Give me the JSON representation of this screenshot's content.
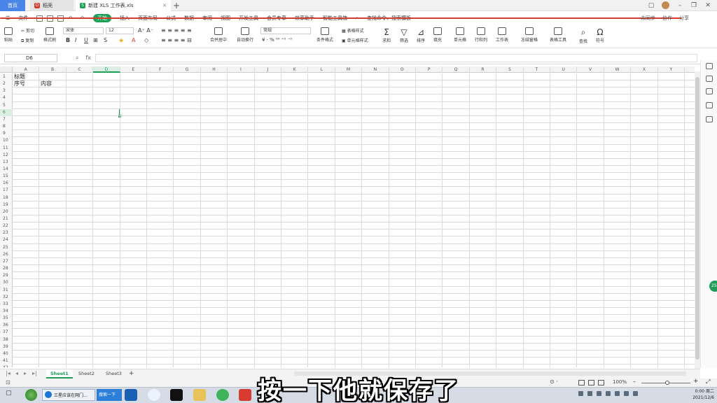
{
  "tabs": {
    "home": "首页",
    "docs": "稻壳",
    "doc": "新建 XLS 工作表.xls",
    "add": "+"
  },
  "menu": {
    "file": "文件",
    "items": [
      "开始",
      "插入",
      "页面布局",
      "公式",
      "数据",
      "审阅",
      "视图",
      "开发工具",
      "会员专享",
      "效率助手",
      "智能工具箱"
    ],
    "search": "查找命令、搜索模板",
    "right": [
      "未同步",
      "协作",
      "分享"
    ]
  },
  "ribbon": {
    "paste": "粘贴",
    "cut": "剪切",
    "copy": "复制",
    "format_painter": "格式刷",
    "font_name": "宋体",
    "font_size": "12",
    "merge": "合并居中",
    "wrap": "自动换行",
    "number_format": "常规",
    "cond_format": "条件格式",
    "table_style": "表格样式",
    "cell_style": "单元格样式",
    "sum": "求和",
    "filter": "筛选",
    "sort": "排序",
    "fill": "填充",
    "cell": "单元格",
    "rowcol": "行和列",
    "sheet": "工作表",
    "freeze": "冻结窗格",
    "table_tools": "表格工具",
    "find": "查找",
    "symbol": "符号"
  },
  "formula": {
    "namebox": "D6",
    "fx": "fx",
    "value": ""
  },
  "columns": [
    "A",
    "B",
    "C",
    "D",
    "E",
    "F",
    "G",
    "H",
    "I",
    "J",
    "K",
    "L",
    "M",
    "N",
    "O",
    "P",
    "Q",
    "R",
    "S",
    "T",
    "U",
    "V",
    "W",
    "X",
    "Y"
  ],
  "selected_column": "D",
  "selected_row": 6,
  "rows": 42,
  "cells": {
    "a1": "标题",
    "a2": "序号",
    "b2": "内容"
  },
  "sheets": [
    "Sheet1",
    "Sheet2",
    "Sheet3"
  ],
  "sheet_add": "+",
  "status": {
    "zoom": "100%"
  },
  "taskbar": {
    "task1": "三星应该在网门...",
    "task2": "搜索一下"
  },
  "clock": {
    "time": "0:00 周二",
    "date": "2021/12/6"
  },
  "badge": "25",
  "subtitle": "按一下他就保存了",
  "colors": {
    "accent": "#1e9e58",
    "home_tab": "#4a86e8",
    "docer": "#d83b2f"
  }
}
